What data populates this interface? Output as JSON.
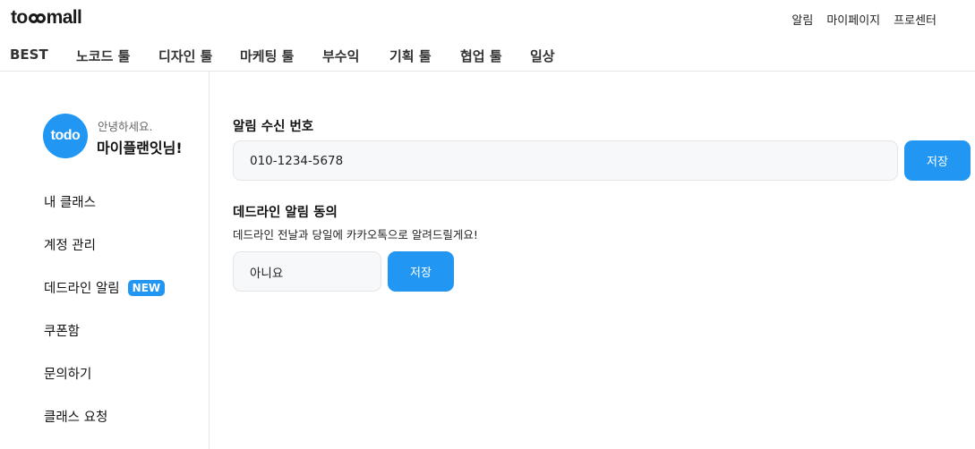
{
  "header": {
    "logo_prefix": "to",
    "logo_suffix": "mall",
    "links": [
      "알림",
      "마이페이지",
      "프로센터"
    ]
  },
  "nav": {
    "items": [
      "BEST",
      "노코드 툴",
      "디자인 툴",
      "마케팅 툴",
      "부수익",
      "기획 툴",
      "협업 툴",
      "일상"
    ]
  },
  "profile": {
    "avatar_text": "todo",
    "greeting": "안녕하세요.",
    "name": "마이플랜잇님!"
  },
  "sidebar": {
    "items": [
      {
        "label": "내 클래스"
      },
      {
        "label": "계정 관리"
      },
      {
        "label": "데드라인 알림",
        "badge": "NEW"
      },
      {
        "label": "쿠폰함"
      },
      {
        "label": "문의하기"
      },
      {
        "label": "클래스 요청"
      }
    ]
  },
  "phone_section": {
    "title": "알림 수신 번호",
    "value": "010-1234-5678",
    "save_label": "저장"
  },
  "deadline_section": {
    "title": "데드라인 알림 동의",
    "description": "데드라인 전날과 당일에 카카오톡으로 알려드릴게요!",
    "selected_option": "아니요",
    "save_label": "저장"
  },
  "colors": {
    "accent": "#2196f3",
    "border": "#e6e6e6",
    "field_bg": "#f7f8fa"
  }
}
